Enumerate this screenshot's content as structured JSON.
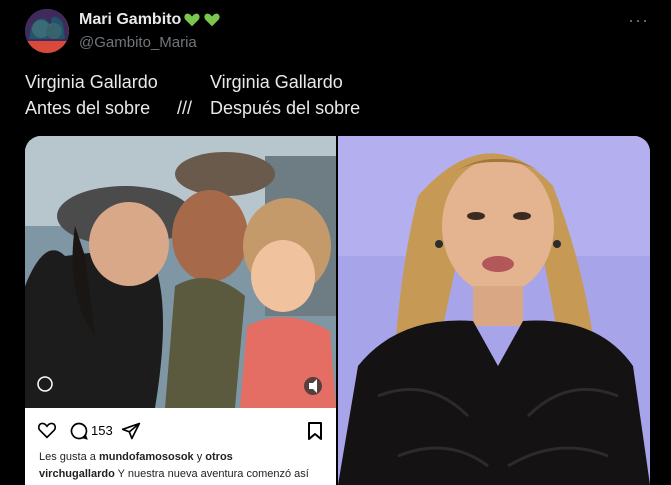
{
  "author": {
    "display_name": "Mari Gambito",
    "handle": "@Gambito_Maria",
    "name_emoji": [
      "green-heart",
      "green-heart"
    ]
  },
  "tweet": {
    "line1_left": "Virginia Gallardo",
    "line1_right": "Virginia Gallardo",
    "line2_left": "Antes del sobre",
    "line2_sep": "///",
    "line2_right": "Después del sobre"
  },
  "more_label": "···",
  "instagram": {
    "comment_count": "153",
    "likes_prefix": "Les gusta a ",
    "likes_user": "mundofamososok",
    "likes_suffix": " y ",
    "likes_others": "otros",
    "caption_user": "virchugallardo",
    "caption_text": " Y nuestra nueva aventura comenzó así"
  },
  "colors": {
    "accent": "#1d9bf0",
    "heart": "#7ac74f",
    "muted": "#71767b"
  }
}
